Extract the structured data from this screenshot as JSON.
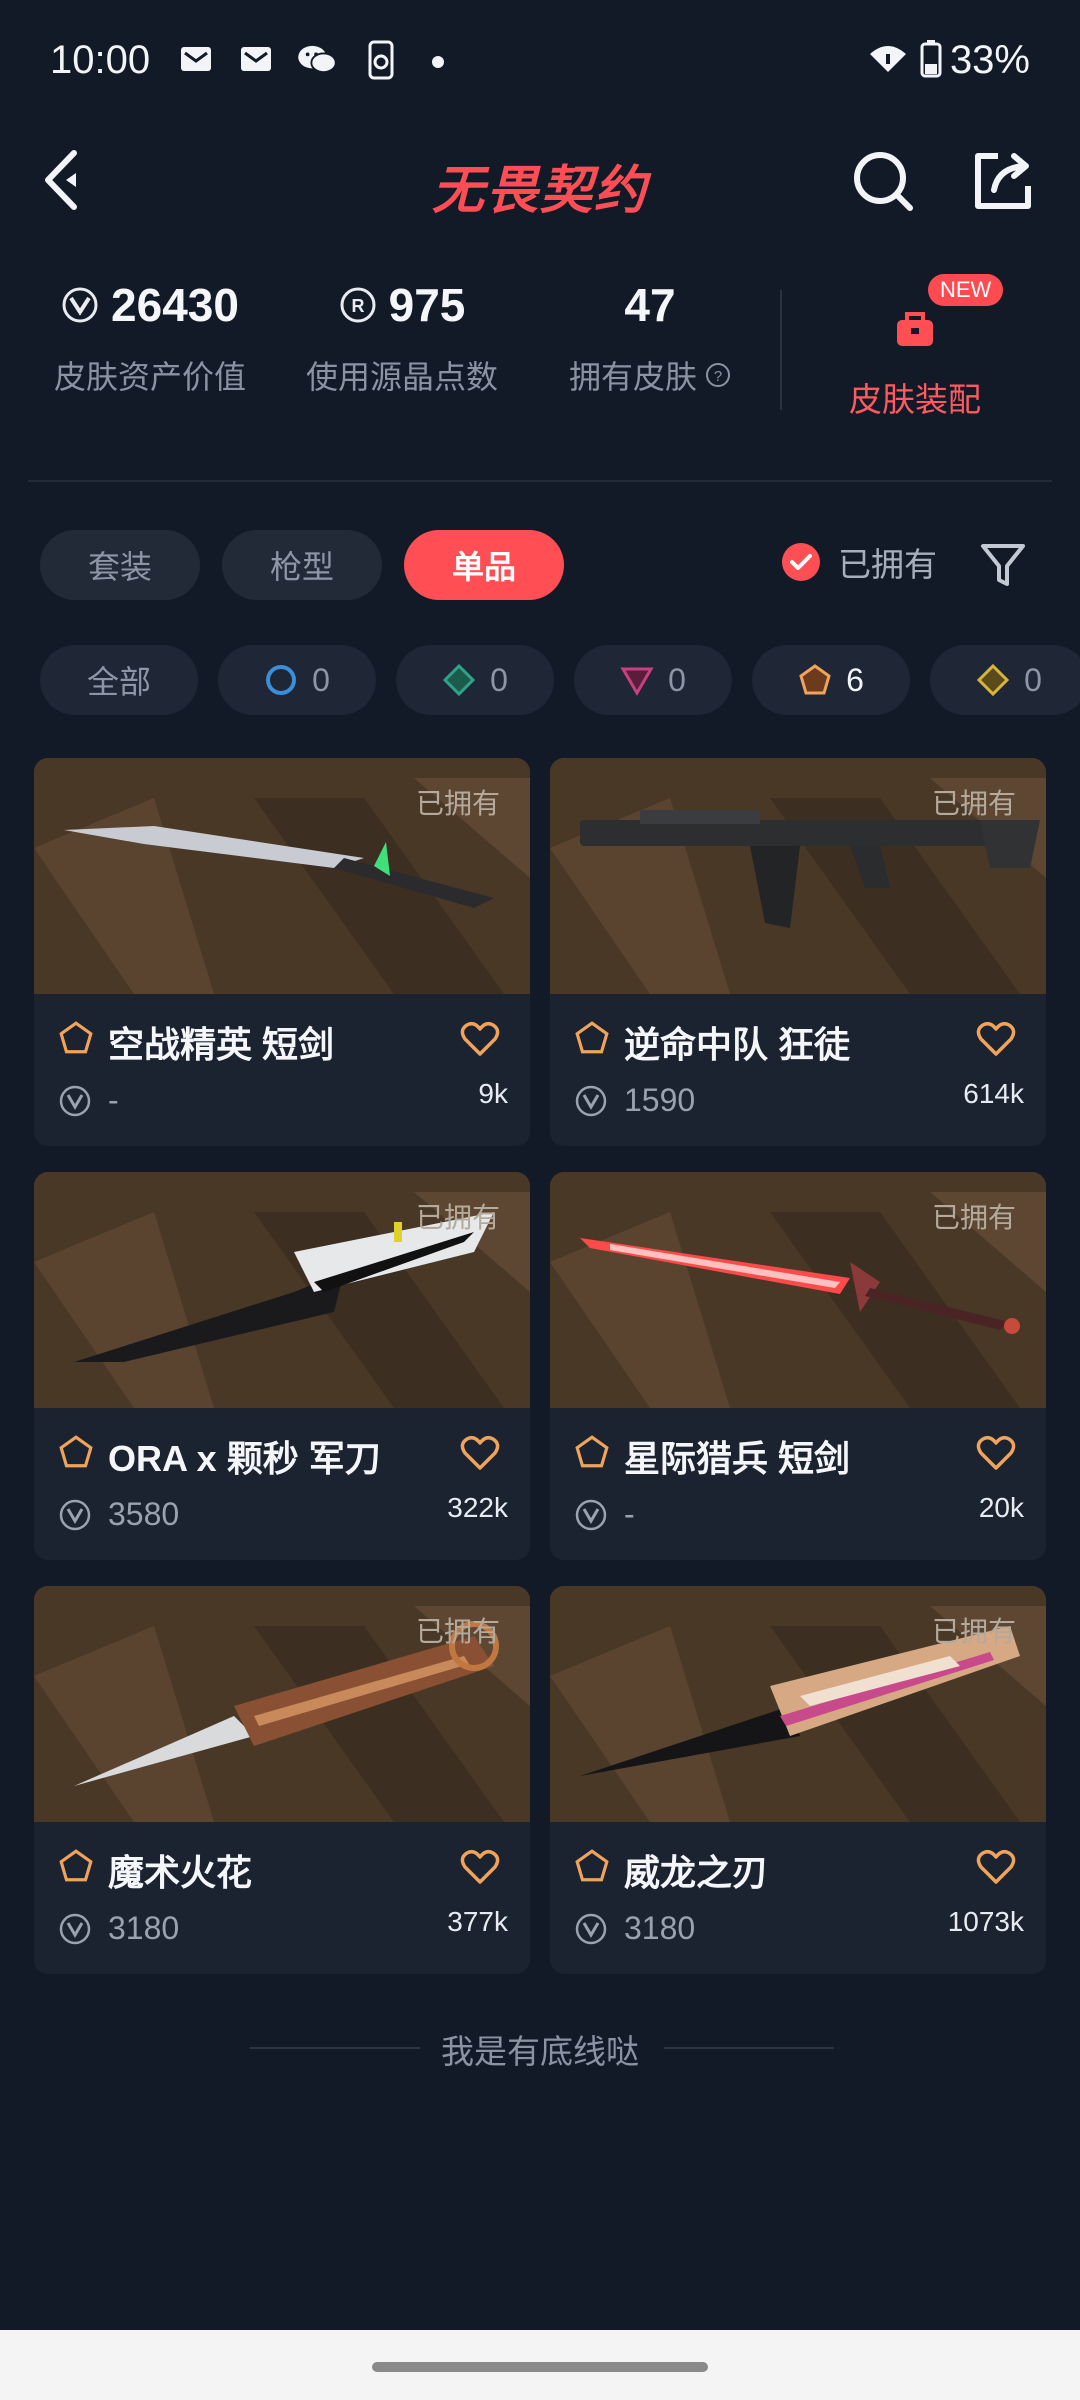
{
  "status_bar": {
    "time": "10:00",
    "battery": "33%"
  },
  "header": {
    "title": "无畏契约"
  },
  "stats": [
    {
      "value": "26430",
      "label": "皮肤资产价值",
      "icon": "vp-icon"
    },
    {
      "value": "975",
      "label": "使用源晶点数",
      "icon": "radianite-icon"
    },
    {
      "value": "47",
      "label": "拥有皮肤",
      "icon": ""
    }
  ],
  "equip": {
    "label": "皮肤装配",
    "badge": "NEW"
  },
  "tabs": [
    "套装",
    "枪型",
    "单品"
  ],
  "active_tab": "单品",
  "owned_filter": {
    "label": "已拥有",
    "checked": true
  },
  "rarity_chips": [
    {
      "label": "全部",
      "count": ""
    },
    {
      "icon": "select-tier-icon",
      "color": "#3a8fd8",
      "count": "0"
    },
    {
      "icon": "deluxe-tier-icon",
      "color": "#2fa38a",
      "count": "0"
    },
    {
      "icon": "premium-tier-icon",
      "color": "#c7407f",
      "count": "0"
    },
    {
      "icon": "exclusive-tier-icon",
      "color": "#f0a35a",
      "count": "6"
    },
    {
      "icon": "ultra-tier-icon",
      "color": "#d8b53a",
      "count": "0"
    }
  ],
  "cards": [
    {
      "name": "空战精英 短剑",
      "price": "-",
      "likes": "9k",
      "tag": "已拥有"
    },
    {
      "name": "逆命中队 狂徒",
      "price": "1590",
      "likes": "614k",
      "tag": "已拥有"
    },
    {
      "name": "ORA x 颗秒 军刀",
      "price": "3580",
      "likes": "322k",
      "tag": "已拥有"
    },
    {
      "name": "星际猎兵 短剑",
      "price": "-",
      "likes": "20k",
      "tag": "已拥有"
    },
    {
      "name": "魔术火花",
      "price": "3180",
      "likes": "377k",
      "tag": "已拥有"
    },
    {
      "name": "威龙之刃",
      "price": "3180",
      "likes": "1073k",
      "tag": "已拥有"
    }
  ],
  "footer": "我是有底线哒",
  "colors": {
    "accent": "#ff4f55",
    "background": "#131a27",
    "card": "#1b2230",
    "tier": "#f0a35a"
  }
}
